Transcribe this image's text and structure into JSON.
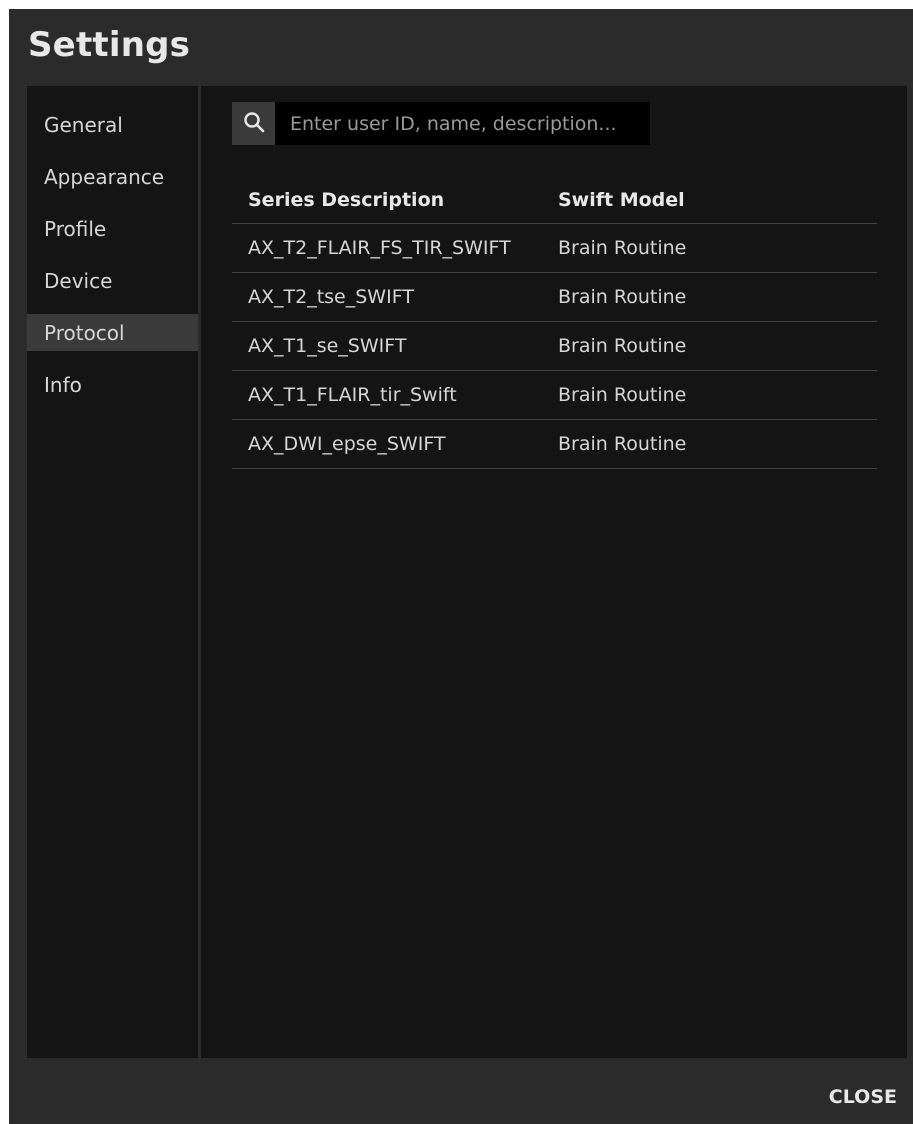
{
  "dialog": {
    "title": "Settings",
    "close_label": "CLOSE"
  },
  "sidebar": {
    "active": "Protocol",
    "items": [
      {
        "label": "General"
      },
      {
        "label": "Appearance"
      },
      {
        "label": "Profile"
      },
      {
        "label": "Device"
      },
      {
        "label": "Protocol"
      },
      {
        "label": "Info"
      }
    ]
  },
  "search": {
    "placeholder": "Enter user ID, name, description...",
    "value": "",
    "icon": "search-icon"
  },
  "table": {
    "headers": [
      "Series Description",
      "Swift Model"
    ],
    "rows": [
      [
        "AX_T2_FLAIR_FS_TIR_SWIFT",
        "Brain Routine"
      ],
      [
        "AX_T2_tse_SWIFT",
        "Brain Routine"
      ],
      [
        "AX_T1_se_SWIFT",
        "Brain Routine"
      ],
      [
        "AX_T1_FLAIR_tir_Swift",
        "Brain Routine"
      ],
      [
        "AX_DWI_epse_SWIFT",
        "Brain Routine"
      ]
    ]
  },
  "colors": {
    "dialog_bg": "#2b2b2b",
    "panel_bg": "#141414",
    "active_item_bg": "#3a3a3a",
    "text": "#d6d6d6",
    "text_strong": "#e8e8e8"
  }
}
